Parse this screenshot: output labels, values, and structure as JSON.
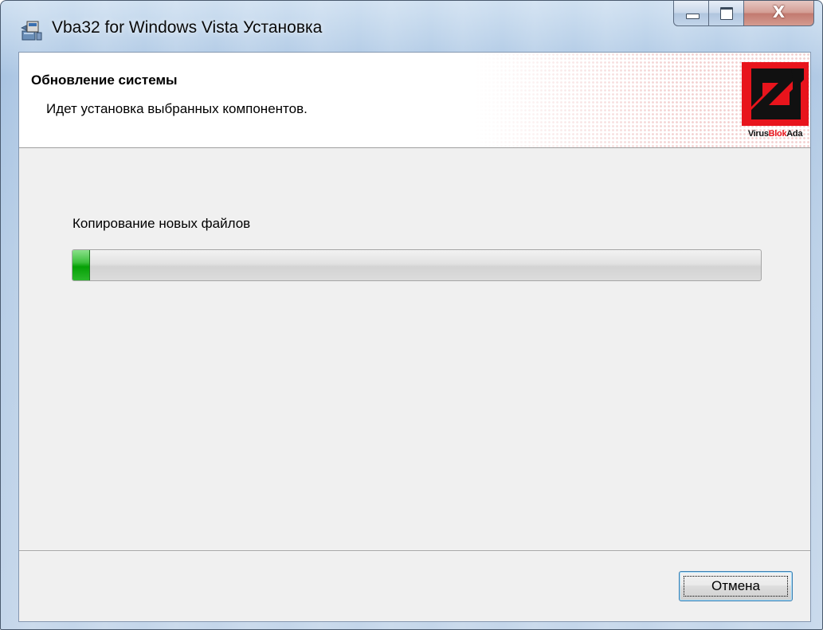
{
  "window": {
    "title": "Vba32 for Windows Vista Установка",
    "icon": "installer-package-icon"
  },
  "caption_buttons": {
    "minimize_icon": "minimize-icon",
    "maximize_icon": "maximize-icon",
    "close_glyph": "X"
  },
  "banner": {
    "title": "Обновление системы",
    "subtitle": "Идет установка выбранных компонентов.",
    "logo": {
      "icon": "virusblokada-logo",
      "text_part1": "Virus",
      "text_part2": "Blok",
      "text_part3": "Ada"
    }
  },
  "progress": {
    "status_text": "Копирование новых файлов",
    "percent": 2.4,
    "color": "#06a006"
  },
  "buttons": {
    "cancel_label": "Отмена"
  },
  "colors": {
    "client_background": "#f0f0f0",
    "banner_background": "#ffffff",
    "logo_red": "#e8141c",
    "logo_black": "#111111"
  }
}
